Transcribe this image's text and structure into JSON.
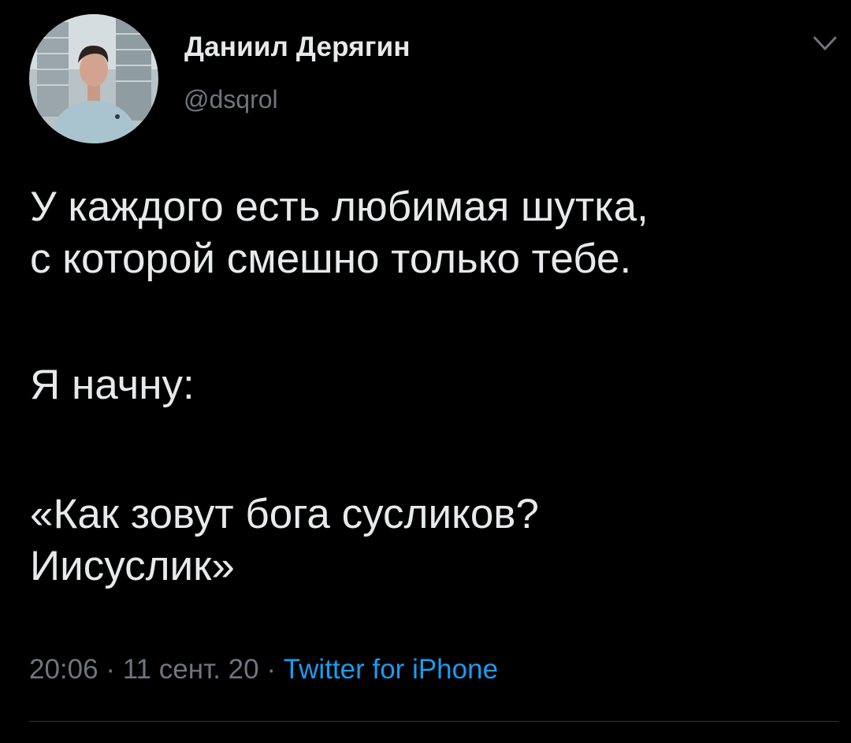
{
  "tweet": {
    "author": {
      "name": "Даниил Дерягин",
      "handle": "@dsqrol",
      "avatar_icon": "profile-photo"
    },
    "menu_icon": "chevron-down-icon",
    "text": {
      "line1": "У каждого есть любимая шутка,",
      "line2": "с которой смешно только тебе.",
      "line3": "Я начну:",
      "line4": "«Как зовут бога сусликов?",
      "line5": "Иисуслик»"
    },
    "meta": {
      "time": "20:06",
      "separator1": " · ",
      "date": "11 сент. 20",
      "separator2": " · ",
      "source": "Twitter for iPhone"
    },
    "colors": {
      "background": "#000000",
      "primary_text": "#e7e9ea",
      "secondary_text": "#6e767d",
      "link": "#1d9bf0"
    }
  }
}
